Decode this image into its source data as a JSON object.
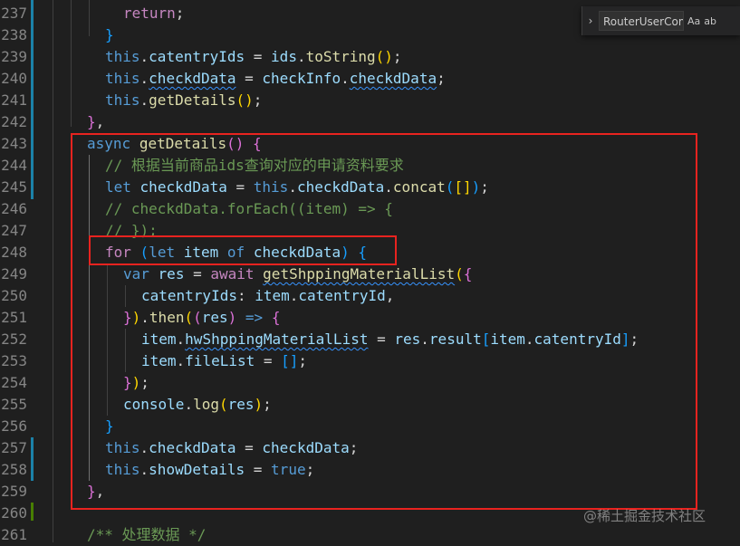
{
  "editor": {
    "lines": [
      {
        "n": "237",
        "segs": [
          [
            "return",
            "ctl"
          ],
          [
            ";",
            "pl"
          ]
        ]
      },
      {
        "n": "238",
        "segs": [
          [
            "}",
            "p3"
          ]
        ]
      },
      {
        "n": "239",
        "segs": [
          [
            "this",
            "kw"
          ],
          [
            ".",
            "pl"
          ],
          [
            "catentryIds",
            "var"
          ],
          [
            " = ",
            "pl"
          ],
          [
            "ids",
            "var"
          ],
          [
            ".",
            "pl"
          ],
          [
            "toString",
            "fn"
          ],
          [
            "()",
            "p1"
          ],
          [
            ";",
            "pl"
          ]
        ]
      },
      {
        "n": "240",
        "segs": [
          [
            "this",
            "kw"
          ],
          [
            ".",
            "pl"
          ],
          [
            "checkdData",
            "var",
            "sq"
          ],
          [
            " = ",
            "pl"
          ],
          [
            "checkInfo",
            "var"
          ],
          [
            ".",
            "pl"
          ],
          [
            "checkdData",
            "var",
            "sq"
          ],
          [
            ";",
            "pl"
          ]
        ]
      },
      {
        "n": "241",
        "segs": [
          [
            "this",
            "kw"
          ],
          [
            ".",
            "pl"
          ],
          [
            "getDetails",
            "fn"
          ],
          [
            "()",
            "p1"
          ],
          [
            ";",
            "pl"
          ]
        ]
      },
      {
        "n": "242",
        "segs": [
          [
            "}",
            "p2"
          ],
          [
            ",",
            "pl"
          ]
        ]
      },
      {
        "n": "243",
        "segs": [
          [
            "async",
            "kw"
          ],
          [
            " ",
            "pl"
          ],
          [
            "getDetails",
            "fn"
          ],
          [
            "()",
            "p2"
          ],
          [
            " ",
            "pl"
          ],
          [
            "{",
            "p2"
          ]
        ]
      },
      {
        "n": "244",
        "segs": [
          [
            "// 根据当前商品ids查询对应的申请资料要求",
            "cm"
          ]
        ]
      },
      {
        "n": "245",
        "segs": [
          [
            "let",
            "kw"
          ],
          [
            " ",
            "pl"
          ],
          [
            "checkdData",
            "var"
          ],
          [
            " = ",
            "pl"
          ],
          [
            "this",
            "kw"
          ],
          [
            ".",
            "pl"
          ],
          [
            "checkdData",
            "var"
          ],
          [
            ".",
            "pl"
          ],
          [
            "concat",
            "fn"
          ],
          [
            "(",
            "p3"
          ],
          [
            "[]",
            "p1"
          ],
          [
            ")",
            "p3"
          ],
          [
            ";",
            "pl"
          ]
        ]
      },
      {
        "n": "246",
        "segs": [
          [
            "// checkdData.forEach((item) => {",
            "cm"
          ]
        ]
      },
      {
        "n": "247",
        "segs": [
          [
            "// });",
            "cm"
          ]
        ]
      },
      {
        "n": "248",
        "segs": [
          [
            "for",
            "ctl"
          ],
          [
            " ",
            "pl"
          ],
          [
            "(",
            "p3"
          ],
          [
            "let",
            "kw"
          ],
          [
            " ",
            "pl"
          ],
          [
            "item",
            "var"
          ],
          [
            " ",
            "pl"
          ],
          [
            "of",
            "kw"
          ],
          [
            " ",
            "pl"
          ],
          [
            "checkdData",
            "var"
          ],
          [
            ")",
            "p3"
          ],
          [
            " ",
            "pl"
          ],
          [
            "{",
            "p3"
          ]
        ]
      },
      {
        "n": "249",
        "segs": [
          [
            "var",
            "kw"
          ],
          [
            " ",
            "pl"
          ],
          [
            "res",
            "var"
          ],
          [
            " = ",
            "pl"
          ],
          [
            "await",
            "ctl"
          ],
          [
            " ",
            "pl"
          ],
          [
            "getShppingMaterialList",
            "fn",
            "sq"
          ],
          [
            "(",
            "p1"
          ],
          [
            "{",
            "p2"
          ]
        ]
      },
      {
        "n": "250",
        "segs": [
          [
            "catentryIds",
            "var"
          ],
          [
            ": ",
            "pl"
          ],
          [
            "item",
            "var"
          ],
          [
            ".",
            "pl"
          ],
          [
            "catentryId",
            "var"
          ],
          [
            ",",
            "pl"
          ]
        ]
      },
      {
        "n": "251",
        "segs": [
          [
            "}",
            "p2"
          ],
          [
            ")",
            "p1"
          ],
          [
            ".",
            "pl"
          ],
          [
            "then",
            "fn"
          ],
          [
            "(",
            "p1"
          ],
          [
            "(",
            "p2"
          ],
          [
            "res",
            "var"
          ],
          [
            ")",
            "p2"
          ],
          [
            " => ",
            "kw"
          ],
          [
            "{",
            "p2"
          ]
        ]
      },
      {
        "n": "252",
        "segs": [
          [
            "item",
            "var"
          ],
          [
            ".",
            "pl"
          ],
          [
            "hwShppingMaterialList",
            "var",
            "sq"
          ],
          [
            " = ",
            "pl"
          ],
          [
            "res",
            "var"
          ],
          [
            ".",
            "pl"
          ],
          [
            "result",
            "var"
          ],
          [
            "[",
            "p3"
          ],
          [
            "item",
            "var"
          ],
          [
            ".",
            "pl"
          ],
          [
            "catentryId",
            "var"
          ],
          [
            "]",
            "p3"
          ],
          [
            ";",
            "pl"
          ]
        ]
      },
      {
        "n": "253",
        "segs": [
          [
            "item",
            "var"
          ],
          [
            ".",
            "pl"
          ],
          [
            "fileList",
            "var"
          ],
          [
            " = ",
            "pl"
          ],
          [
            "[]",
            "p3"
          ],
          [
            ";",
            "pl"
          ]
        ]
      },
      {
        "n": "254",
        "segs": [
          [
            "}",
            "p2"
          ],
          [
            ")",
            "p1"
          ],
          [
            ";",
            "pl"
          ]
        ]
      },
      {
        "n": "255",
        "segs": [
          [
            "console",
            "var"
          ],
          [
            ".",
            "pl"
          ],
          [
            "log",
            "fn"
          ],
          [
            "(",
            "p1"
          ],
          [
            "res",
            "var"
          ],
          [
            ")",
            "p1"
          ],
          [
            ";",
            "pl"
          ]
        ]
      },
      {
        "n": "256",
        "segs": [
          [
            "}",
            "p3"
          ]
        ]
      },
      {
        "n": "257",
        "segs": [
          [
            "this",
            "kw"
          ],
          [
            ".",
            "pl"
          ],
          [
            "checkdData",
            "var"
          ],
          [
            " = ",
            "pl"
          ],
          [
            "checkdData",
            "var"
          ],
          [
            ";",
            "pl"
          ]
        ]
      },
      {
        "n": "258",
        "segs": [
          [
            "this",
            "kw"
          ],
          [
            ".",
            "pl"
          ],
          [
            "showDetails",
            "var"
          ],
          [
            " = ",
            "pl"
          ],
          [
            "true",
            "kw"
          ],
          [
            ";",
            "pl"
          ]
        ]
      },
      {
        "n": "259",
        "segs": [
          [
            "}",
            "p2"
          ],
          [
            ",",
            "pl"
          ]
        ]
      },
      {
        "n": "260",
        "segs": []
      },
      {
        "n": "261",
        "segs": [
          [
            "/** 处理数据 */",
            "cm"
          ]
        ]
      }
    ]
  },
  "find_widget": {
    "toggle_icon": "chevron-right-icon",
    "input_value": "RouterUserComp",
    "match_case_label": "Aa",
    "whole_word_label": "ab"
  },
  "watermark": "@稀土掘金技术社区",
  "colors": {
    "background": "#1f1f1f",
    "highlight_box": "#e8231f",
    "modified_bar": "#1b81a8",
    "added_bar": "#487e02"
  }
}
